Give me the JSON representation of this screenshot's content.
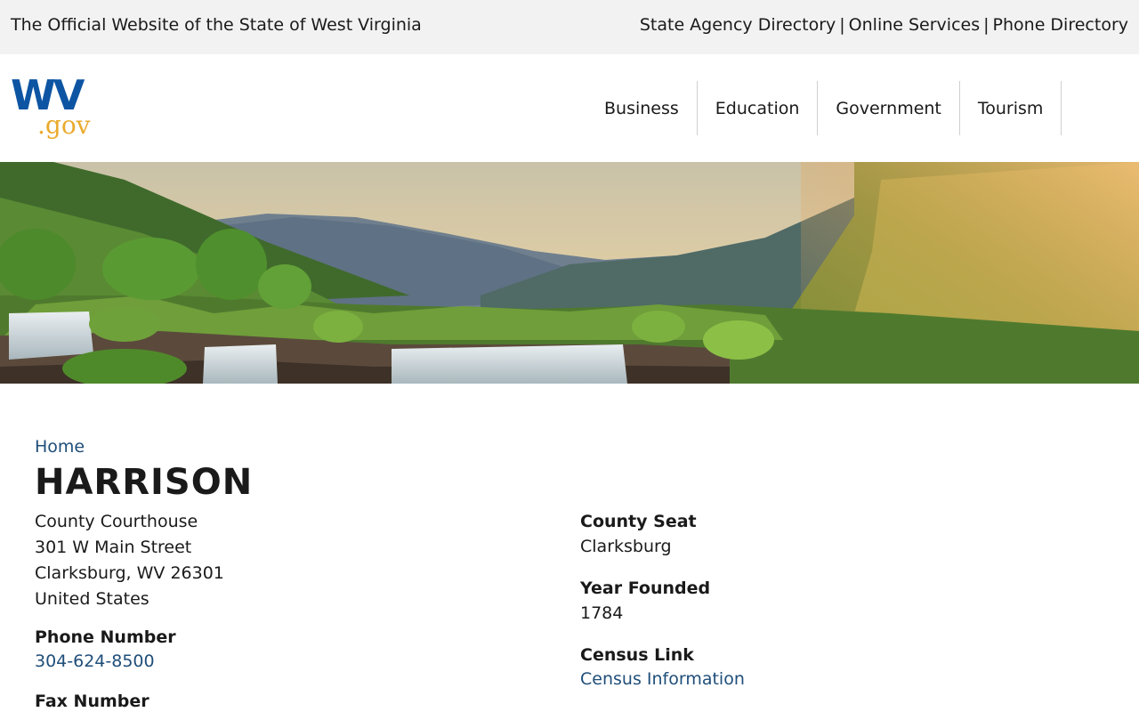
{
  "topbar": {
    "title": "The Official Website of the State of West Virginia",
    "links": [
      "State Agency Directory",
      "Online Services",
      "Phone Directory"
    ],
    "separator": "|"
  },
  "logo": {
    "wv_text": "WV",
    "gov_text": ".gov",
    "wv_color": "#0d55a3",
    "gov_color": "#eaaa2e"
  },
  "nav": {
    "items": [
      "Business",
      "Education",
      "Government",
      "Tourism"
    ]
  },
  "breadcrumb": {
    "home": "Home"
  },
  "page": {
    "title": "HARRISON"
  },
  "address": {
    "line1": "County Courthouse",
    "line2": "301 W Main Street",
    "line3": "Clarksburg, WV 26301",
    "line4": "United States"
  },
  "phone": {
    "label": "Phone Number",
    "value": "304-624-8500"
  },
  "fax": {
    "label": "Fax Number"
  },
  "county_seat": {
    "label": "County Seat",
    "value": "Clarksburg"
  },
  "year_founded": {
    "label": "Year Founded",
    "value": "1784"
  },
  "census": {
    "label": "Census Link",
    "value": "Census Information"
  },
  "colors": {
    "link": "#1f4e79",
    "topbar_bg": "#f2f2f2"
  }
}
